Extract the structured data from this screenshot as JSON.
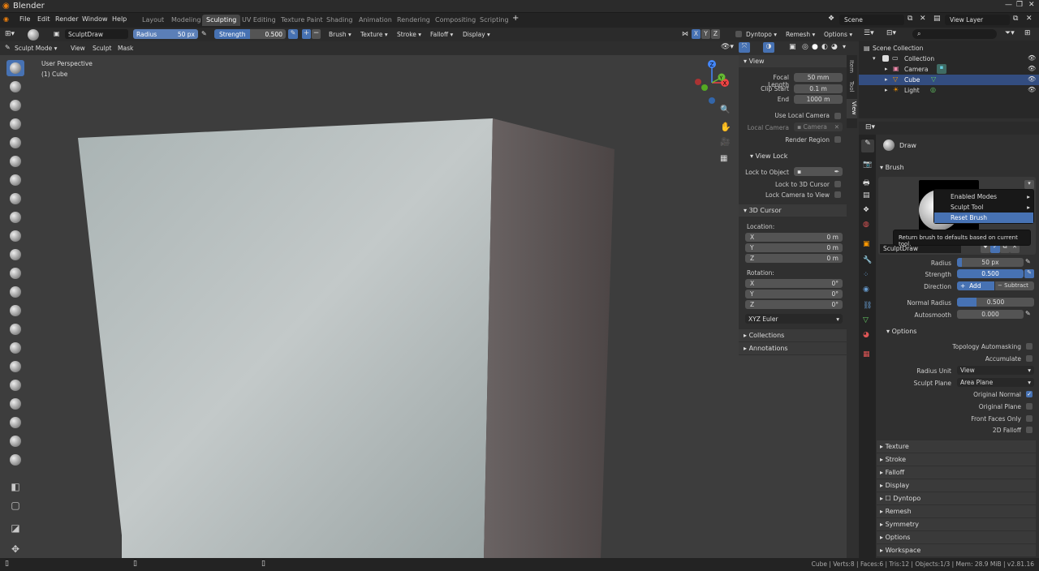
{
  "app": {
    "title": "Blender"
  },
  "menu": {
    "items": [
      "File",
      "Edit",
      "Render",
      "Window",
      "Help"
    ]
  },
  "workspaces": [
    "Layout",
    "Modeling",
    "Sculpting",
    "UV Editing",
    "Texture Paint",
    "Shading",
    "Animation",
    "Rendering",
    "Compositing",
    "Scripting"
  ],
  "active_workspace": "Sculpting",
  "add_tab": "+",
  "scene": {
    "label": "Scene",
    "view_layer": "View Layer"
  },
  "tool_header": {
    "brush_name": "SculptDraw",
    "radius_label": "Radius",
    "radius_value": "50 px",
    "strength_label": "Strength",
    "strength_value": "0.500",
    "menus": [
      "Brush",
      "Texture",
      "Stroke",
      "Falloff",
      "Display"
    ],
    "axes": [
      "X",
      "Y",
      "Z"
    ],
    "dyntopo": "Dyntopo",
    "remesh": "Remesh",
    "options": "Options"
  },
  "mode_header": {
    "mode": "Sculpt Mode",
    "menus": [
      "View",
      "Sculpt",
      "Mask"
    ]
  },
  "viewport": {
    "perspective": "User Perspective",
    "object": "(1) Cube"
  },
  "gizmo": {
    "x": "X",
    "y": "Y",
    "z": "Z"
  },
  "npanel": {
    "tabs": [
      "Item",
      "Tool",
      "View"
    ],
    "view": {
      "title": "View",
      "focal_length_label": "Focal Length",
      "focal_length": "50 mm",
      "clip_start_label": "Clip Start",
      "clip_start": "0.1 m",
      "end_label": "End",
      "end": "1000 m",
      "use_local_camera": "Use Local Camera",
      "local_camera": "Local Camera",
      "camera": "Camera",
      "render_region": "Render Region"
    },
    "view_lock": {
      "title": "View Lock",
      "lock_to_object": "Lock to Object",
      "lock_to_3d_cursor": "Lock to 3D Cursor",
      "lock_camera_to_view": "Lock Camera to View"
    },
    "cursor": {
      "title": "3D Cursor",
      "location": "Location:",
      "rotation": "Rotation:",
      "x": "X",
      "y": "Y",
      "z": "Z",
      "loc_x": "0 m",
      "loc_y": "0 m",
      "loc_z": "0 m",
      "rot_x": "0°",
      "rot_y": "0°",
      "rot_z": "0°",
      "euler": "XYZ Euler"
    },
    "collections": "Collections",
    "annotations": "Annotations"
  },
  "outliner": {
    "root": "Scene Collection",
    "collection": "Collection",
    "items": [
      "Camera",
      "Cube",
      "Light"
    ]
  },
  "properties": {
    "tool_name": "Draw",
    "brush_section": "Brush",
    "brush_field": "SculptDraw",
    "radius_label": "Radius",
    "radius": "50 px",
    "strength_label": "Strength",
    "strength": "0.500",
    "direction_label": "Direction",
    "add": "Add",
    "subtract": "Subtract",
    "normal_radius_label": "Normal Radius",
    "normal_radius": "0.500",
    "autosmooth_label": "Autosmooth",
    "autosmooth": "0.000",
    "options_section": "Options",
    "topology_automasking": "Topology Automasking",
    "accumulate": "Accumulate",
    "radius_unit_label": "Radius Unit",
    "radius_unit": "View",
    "sculpt_plane_label": "Sculpt Plane",
    "sculpt_plane": "Area Plane",
    "original_normal": "Original Normal",
    "original_plane": "Original Plane",
    "front_faces_only": "Front Faces Only",
    "falloff_2d": "2D Falloff",
    "sections": [
      "Texture",
      "Stroke",
      "Falloff",
      "Display",
      "Dyntopo",
      "Remesh",
      "Symmetry",
      "Options",
      "Workspace"
    ]
  },
  "context_menu": {
    "items": [
      "Enabled Modes",
      "Sculpt Tool",
      "Reset Brush"
    ]
  },
  "tooltip": "Return brush to defaults based on current tool.",
  "status": {
    "text": "Cube | Verts:8 | Faces:6 | Tris:12 | Objects:1/3 | Mem: 28.9 MiB | v2.81.16"
  },
  "colors": {
    "accent": "#4772b3",
    "bg": "#303030",
    "viewport": "#3d3d3d",
    "cube_front": "#b8bfbf",
    "cube_side": "#5a5454"
  }
}
